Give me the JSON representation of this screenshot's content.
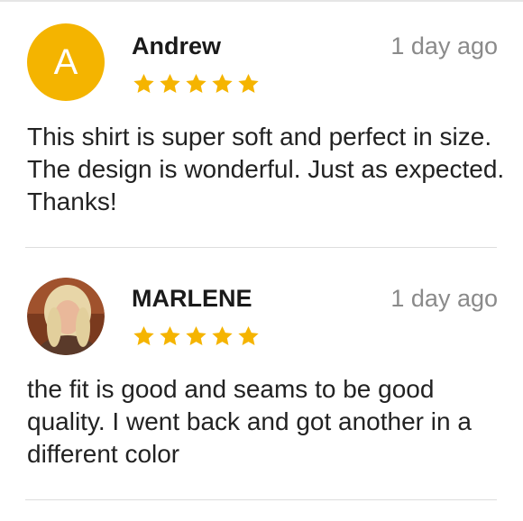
{
  "reviews": [
    {
      "avatar_letter": "A",
      "avatar_color": "#f4b400",
      "name": "Andrew",
      "time": "1 day ago",
      "rating": 5,
      "text": "This shirt is super soft and perfect in size. The design is wonderful. Just as expected. Thanks!"
    },
    {
      "avatar_letter": "",
      "avatar_color": "#8a4a2a",
      "name": "MARLENE",
      "time": "1 day ago",
      "rating": 5,
      "text": "the fit is good and seams to be good quality. I went back and got another in a different color"
    }
  ],
  "colors": {
    "star": "#f5b400",
    "divider": "#dddddd",
    "muted": "#8a8a8a"
  },
  "icons": {
    "star": "star-icon",
    "photo_avatar": "user-photo-avatar"
  }
}
